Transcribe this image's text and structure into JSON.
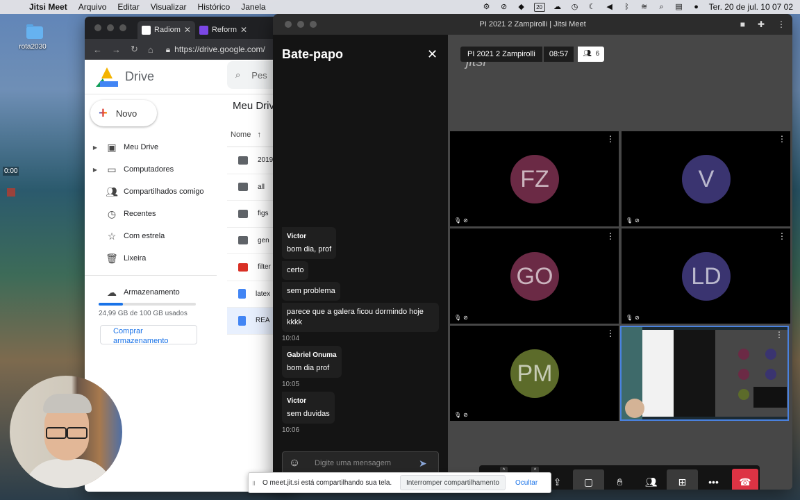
{
  "menubar": {
    "app_name": "Jitsi Meet",
    "menus": [
      "Arquivo",
      "Editar",
      "Visualizar",
      "Histórico",
      "Janela"
    ],
    "calendar_day": "20",
    "clock": "Ter. 20 de jul.  10 07 02"
  },
  "desktop": {
    "folder_label": "rota2030",
    "recorder_time": "0:00"
  },
  "chrome": {
    "tabs": [
      {
        "label": "Radiom",
        "icon": "doc-icon"
      },
      {
        "label": "Reform",
        "icon": "forms-icon"
      }
    ],
    "url": "https://drive.google.com/"
  },
  "drive": {
    "app_title": "Drive",
    "search_placeholder": "Pes",
    "new_label": "Novo",
    "nav": [
      {
        "label": "Meu Drive",
        "icon": "drive-icon",
        "expandable": true
      },
      {
        "label": "Computadores",
        "icon": "computers-icon",
        "expandable": true
      },
      {
        "label": "Compartilhados comigo",
        "icon": "shared-icon",
        "expandable": false
      },
      {
        "label": "Recentes",
        "icon": "clock-icon",
        "expandable": false
      },
      {
        "label": "Com estrela",
        "icon": "star-icon",
        "expandable": false
      },
      {
        "label": "Lixeira",
        "icon": "trash-icon",
        "expandable": false
      }
    ],
    "storage_label": "Armazenamento",
    "storage_fraction": 0.25,
    "storage_text": "24,99 GB de 100 GB usados",
    "buy_label": "Comprar armazenamento",
    "files_title": "Meu Drive",
    "col_name": "Nome",
    "files": [
      {
        "name": "2019",
        "type": "folder"
      },
      {
        "name": "all",
        "type": "folder"
      },
      {
        "name": "figs",
        "type": "folder"
      },
      {
        "name": "gen",
        "type": "folder"
      },
      {
        "name": "filter",
        "type": "code"
      },
      {
        "name": "latex",
        "type": "doc"
      },
      {
        "name": "REA",
        "type": "doc",
        "selected": true
      }
    ]
  },
  "jitsi": {
    "window_title": "PI 2021 2 Zampirolli | Jitsi Meet",
    "chat_title": "Bate-papo",
    "messages": [
      {
        "sender": "Victor",
        "text": "bom dia, prof"
      },
      {
        "sender": "",
        "text": "certo"
      },
      {
        "sender": "",
        "text": "sem problema"
      },
      {
        "sender": "",
        "text": "parece que a galera ficou dormindo hoje kkkk",
        "time": "10:04"
      },
      {
        "sender": "Gabriel Onuma",
        "text": "bom dia prof",
        "time": "10:05"
      },
      {
        "sender": "Victor",
        "text": "sem duvidas",
        "time": "10:06"
      }
    ],
    "composer_placeholder": "Digite uma mensagem",
    "watermark": "jitsi",
    "meeting_name": "PI 2021 2 Zampirolli",
    "meeting_time": "08:57",
    "participant_count": "6",
    "participants": [
      {
        "initials": "FZ",
        "color": "#6b2a45"
      },
      {
        "initials": "V",
        "color": "#3a3470"
      },
      {
        "initials": "GO",
        "color": "#6b2a45"
      },
      {
        "initials": "LD",
        "color": "#3a3470"
      },
      {
        "initials": "PM",
        "color": "#5c6b2a"
      }
    ],
    "share_notice": "O meet.jit.si está compartilhando sua tela.",
    "share_stop": "Interromper compartilhamento",
    "share_hide": "Ocultar"
  }
}
